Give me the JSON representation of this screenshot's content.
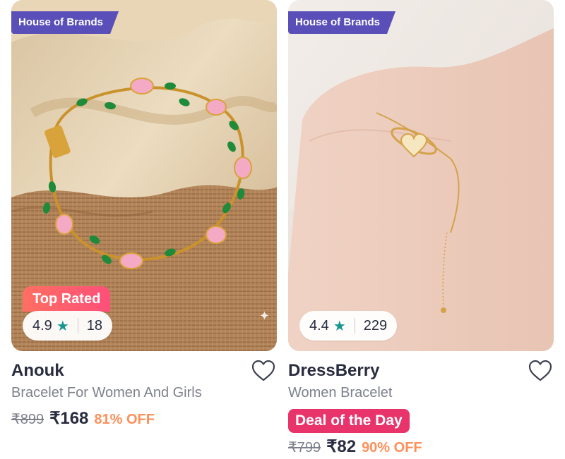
{
  "products": [
    {
      "badge": "House of Brands",
      "tag": "Top Rated",
      "rating": "4.9",
      "rating_star": "★",
      "rating_count": "18",
      "brand": "Anouk",
      "title": "Bracelet For Women And Girls",
      "mrp": "₹899",
      "price": "₹168",
      "discount": "81% OFF"
    },
    {
      "badge": "House of Brands",
      "rating": "4.4",
      "rating_star": "★",
      "rating_count": "229",
      "brand": "DressBerry",
      "title": "Women Bracelet",
      "deal": "Deal of the Day",
      "mrp": "₹799",
      "price": "₹82",
      "discount": "90% OFF"
    }
  ],
  "colors": {
    "badge_bg": "#5a4fb8",
    "star": "#14958f",
    "discount": "#ff905a",
    "deal_bg": "#e8336b",
    "top_rated_gradient": [
      "#ff6f61",
      "#ff4f7a"
    ]
  },
  "icons": {
    "wishlist": "heart-outline-icon",
    "rating": "star-icon",
    "sparkle": "sparkle-icon"
  }
}
